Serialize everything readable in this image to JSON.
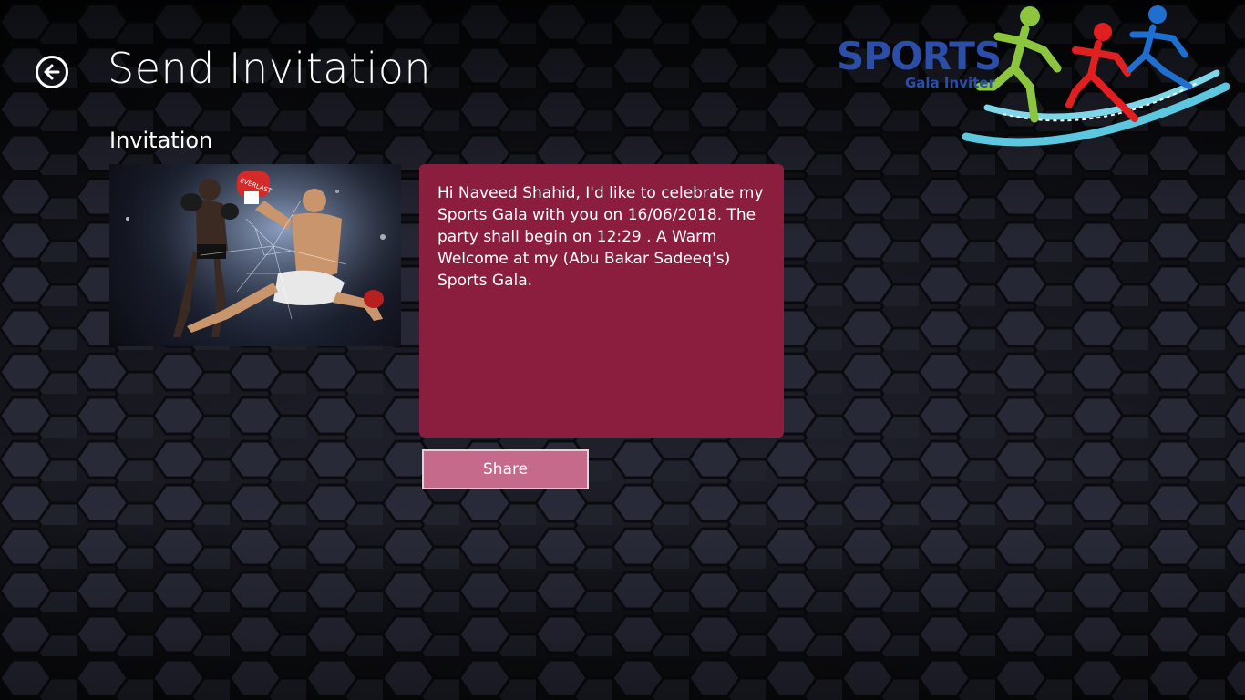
{
  "header": {
    "title": "Send Invitation"
  },
  "invitation": {
    "heading": "Invitation",
    "message": "Hi Naveed Shahid, I'd like to celebrate my Sports Gala with you on 16/06/2018. The party shall begin on 12:29 . A Warm Welcome at my (Abu Bakar Sadeeq's) Sports Gala.",
    "share_label": "Share"
  },
  "photo": {
    "glove_brand": "EVERLAST"
  },
  "logo": {
    "brand": "SPORTS",
    "subtitle": "Gala Inviter"
  },
  "colors": {
    "message_bg": "#8b1e3f",
    "share_bg": "#c56a8b",
    "logo_blue": "#2b4fa8",
    "runner_green": "#8cc63f",
    "runner_red": "#e02020",
    "runner_blue": "#1f6fd1",
    "swoosh": "#5bc8e0"
  }
}
